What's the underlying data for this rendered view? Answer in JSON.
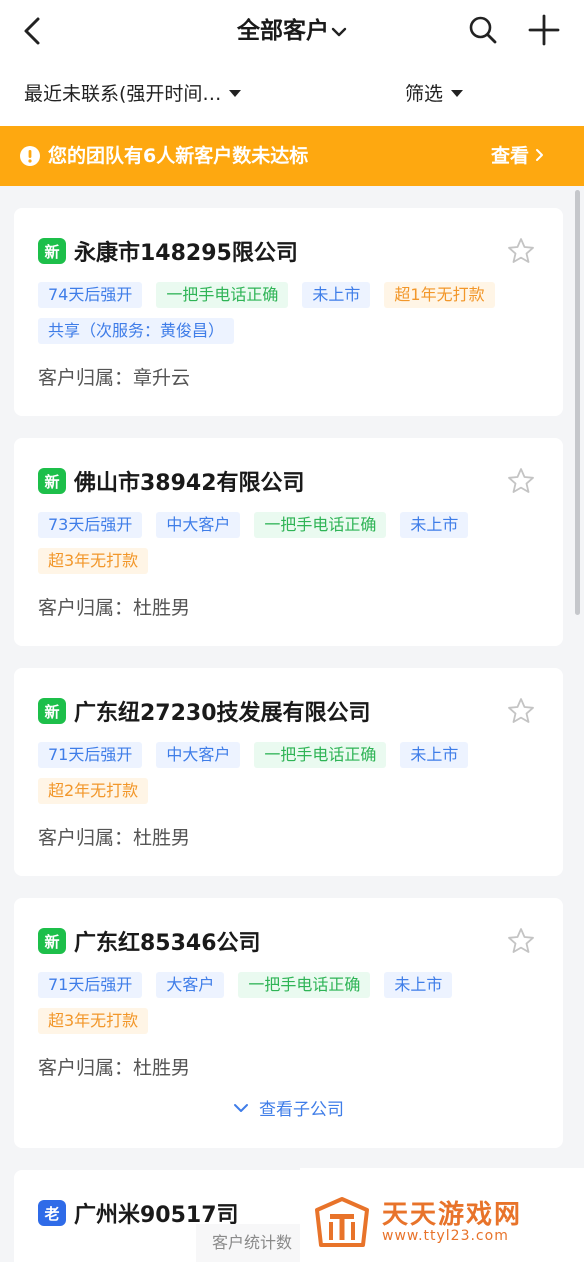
{
  "header": {
    "title": "全部客户"
  },
  "filters": {
    "sort_label": "最近未联系(强开时间…",
    "filter_label": "筛选"
  },
  "banner": {
    "text": "您的团队有6人新客户数未达标",
    "action": "查看"
  },
  "customers": [
    {
      "badge": "新",
      "name": "永康市148295限公司",
      "tags": [
        "74天后强开",
        "一把手电话正确",
        "未上市",
        "超1年无打款",
        "共享（次服务：黄俊昌）"
      ],
      "owner_label": "客户归属：",
      "owner": "章升云"
    },
    {
      "badge": "新",
      "name": "佛山市38942有限公司",
      "tags": [
        "73天后强开",
        "中大客户",
        "一把手电话正确",
        "未上市",
        "超3年无打款"
      ],
      "owner_label": "客户归属：",
      "owner": "杜胜男"
    },
    {
      "badge": "新",
      "name": "广东纽27230技发展有限公司",
      "tags": [
        "71天后强开",
        "中大客户",
        "一把手电话正确",
        "未上市",
        "超2年无打款"
      ],
      "owner_label": "客户归属：",
      "owner": "杜胜男"
    },
    {
      "badge": "新",
      "name": "广东红85346公司",
      "tags": [
        "71天后强开",
        "大客户",
        "一把手电话正确",
        "未上市",
        "超3年无打款"
      ],
      "owner_label": "客户归属：",
      "owner": "杜胜男",
      "sub_link": "查看子公司"
    },
    {
      "badge": "老",
      "name": "广州米90517司"
    }
  ],
  "footer": {
    "stats_label": "客户统计数"
  },
  "watermark": {
    "name": "天天游戏网",
    "url": "www.ttyl23.com"
  },
  "colors": {
    "banner": "#fea810",
    "new_badge": "#1dbf4a",
    "old_badge": "#2f6be8",
    "tag_blue": "#3f7de8",
    "tag_green": "#2fb456",
    "tag_orange": "#f2972a"
  }
}
